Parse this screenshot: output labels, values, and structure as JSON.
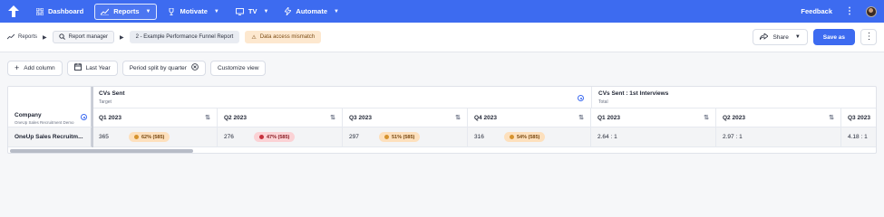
{
  "nav": {
    "items": [
      {
        "label": "Dashboard",
        "icon": "grid-icon",
        "active": false,
        "dropdown": false
      },
      {
        "label": "Reports",
        "icon": "chart-icon",
        "active": true,
        "dropdown": true
      },
      {
        "label": "Motivate",
        "icon": "trophy-icon",
        "active": false,
        "dropdown": true
      },
      {
        "label": "TV",
        "icon": "monitor-icon",
        "active": false,
        "dropdown": true
      },
      {
        "label": "Automate",
        "icon": "lightning-icon",
        "active": false,
        "dropdown": true
      }
    ],
    "feedback_label": "Feedback"
  },
  "breadcrumb": {
    "reports": "Reports",
    "report_manager": "Report manager",
    "current": "2 - Example Performance Funnel Report",
    "warning": "Data access mismatch"
  },
  "actions": {
    "share": "Share",
    "save_as": "Save as"
  },
  "toolbar": {
    "add_column": "Add column",
    "date_range": "Last Year",
    "period_split": "Period split by quarter",
    "customize": "Customize view"
  },
  "table": {
    "company_header": "Company",
    "company_sub": "OneUp Sales Recruitment Demo",
    "groups": [
      {
        "title": "CVs Sent",
        "subtitle": "Target"
      },
      {
        "title": "CVs Sent : 1st Interviews",
        "subtitle": "Total"
      }
    ],
    "quarters": [
      "Q1 2023",
      "Q2 2023",
      "Q3 2023",
      "Q4 2023",
      "Q1 2023",
      "Q2 2023",
      "Q3 2023"
    ],
    "row": {
      "company": "OneUp Sales Recruitm...",
      "cells": [
        {
          "value": "365",
          "badge": "62% (585)",
          "status": "amber"
        },
        {
          "value": "276",
          "badge": "47% (585)",
          "status": "red"
        },
        {
          "value": "297",
          "badge": "51% (585)",
          "status": "amber"
        },
        {
          "value": "316",
          "badge": "54% (585)",
          "status": "amber"
        },
        {
          "value": "2.64 : 1",
          "badge": "",
          "status": ""
        },
        {
          "value": "2.97 : 1",
          "badge": "",
          "status": ""
        },
        {
          "value": "4.18 : 1",
          "badge": "",
          "status": ""
        }
      ]
    }
  },
  "colors": {
    "brand": "#3d6bf0",
    "amber": "#d6932e",
    "red": "#c6313d"
  }
}
